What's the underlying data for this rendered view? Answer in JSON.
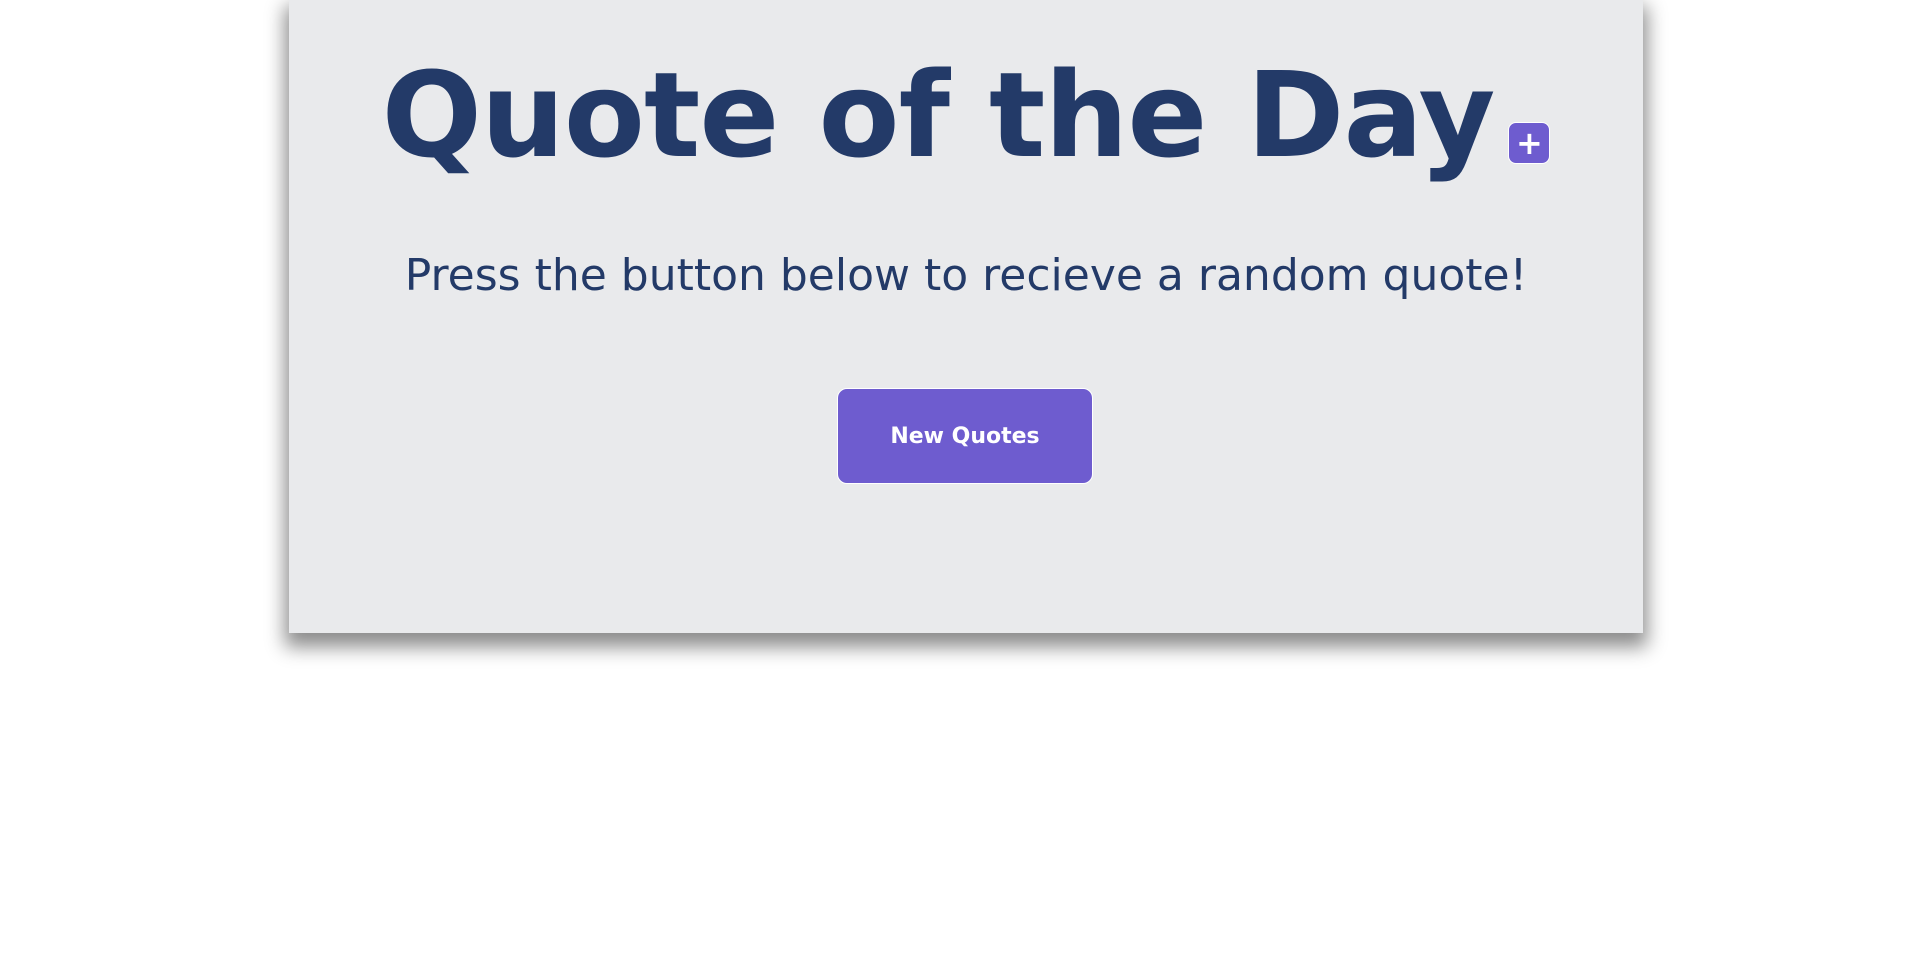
{
  "header": {
    "title": "Quote of the Day",
    "add_button_symbol": "+",
    "add_button_icon": "plus-icon"
  },
  "main": {
    "subtitle": "Press the button below to recieve a random quote!",
    "new_quotes_label": "New Quotes"
  },
  "colors": {
    "title_text": "#233a68",
    "accent": "#6e5ccf",
    "card_background": "#e9eaec",
    "page_background": "#ffffff"
  }
}
